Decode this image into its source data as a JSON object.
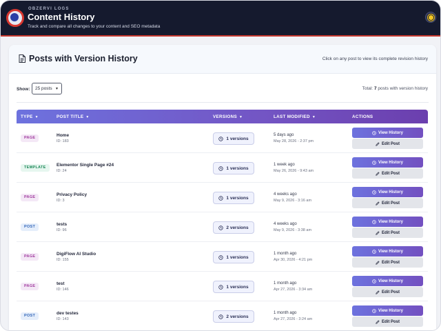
{
  "header": {
    "brand_small": "OBZERVI LOGS",
    "title": "Content History",
    "subtitle": "Track and compare all changes to your content and SEO metadata"
  },
  "section": {
    "title": "Posts with Version History",
    "hint": "Click on any post to view its complete revision history"
  },
  "controls": {
    "show_label": "Show:",
    "per_page": "25 posts",
    "total_prefix": "Total:",
    "total_count": "7",
    "total_suffix": "posts with version history"
  },
  "table": {
    "columns": {
      "type": "TYPE",
      "title": "POST TITLE",
      "versions": "VERSIONS",
      "modified": "LAST MODIFIED",
      "actions": "ACTIONS"
    },
    "view_label": "View History",
    "edit_label": "Edit Post",
    "rows": [
      {
        "type": "PAGE",
        "kind": "page",
        "title": "Home",
        "id": "ID: 183",
        "versions": "1 versions",
        "rel": "5 days ago",
        "date": "May 28, 2026 - 2:37 pm"
      },
      {
        "type": "TEMPLATE",
        "kind": "template",
        "title": "Elementor Single Page #24",
        "id": "ID: 24",
        "versions": "1 versions",
        "rel": "1 week ago",
        "date": "May 26, 2026 - 9:43 am"
      },
      {
        "type": "PAGE",
        "kind": "page",
        "title": "Privacy Policy",
        "id": "ID: 3",
        "versions": "1 versions",
        "rel": "4 weeks ago",
        "date": "May 9, 2026 - 3:16 am"
      },
      {
        "type": "POST",
        "kind": "post",
        "title": "tests",
        "id": "ID: 96",
        "versions": "2 versions",
        "rel": "4 weeks ago",
        "date": "May 9, 2026 - 3:38 am"
      },
      {
        "type": "PAGE",
        "kind": "page",
        "title": "DigiFlow AI Studio",
        "id": "ID: 155",
        "versions": "1 versions",
        "rel": "1 month ago",
        "date": "Apr 30, 2026 - 4:21 pm"
      },
      {
        "type": "PAGE",
        "kind": "page",
        "title": "test",
        "id": "ID: 146",
        "versions": "1 versions",
        "rel": "1 month ago",
        "date": "Apr 27, 2026 - 3:34 am"
      },
      {
        "type": "POST",
        "kind": "post",
        "title": "dev testes",
        "id": "ID: 143",
        "versions": "2 versions",
        "rel": "1 month ago",
        "date": "Apr 27, 2026 - 3:24 am"
      }
    ]
  },
  "colors": {
    "header_bg": "#151a2e",
    "accent_red": "#c7382f",
    "table_gradient_start": "#6d72de",
    "table_gradient_end": "#6b3fae"
  }
}
